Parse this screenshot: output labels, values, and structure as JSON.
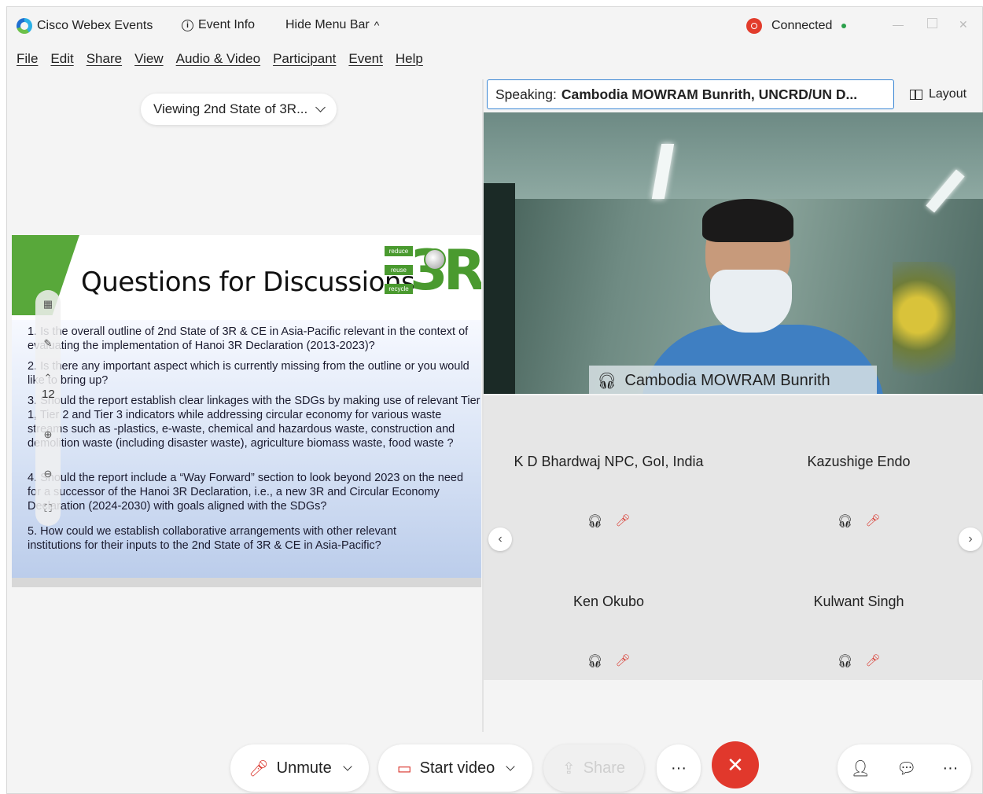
{
  "titlebar": {
    "app_name": "Cisco Webex Events",
    "event_info": "Event Info",
    "hide_menu": "Hide Menu Bar",
    "hide_menu_caret": "^",
    "status": "Connected"
  },
  "menu": [
    "File",
    "Edit",
    "Share",
    "View",
    "Audio & Video",
    "Participant",
    "Event",
    "Help"
  ],
  "viewing": {
    "label": "Viewing 2nd State of 3R..."
  },
  "slide": {
    "title": "Questions for Discussions",
    "logo_text": "3R",
    "logo_tags": [
      "reduce",
      "reuse",
      "recycle"
    ],
    "questions": [
      "1. Is the overall outline of 2nd State of 3R & CE in Asia-Pacific relevant in the context of evaluating the implementation of Hanoi 3R Declaration (2013-2023)?",
      "2. Is there any important aspect which is currently missing from the outline or you would like to bring up?",
      "3. Should the report establish clear linkages with the SDGs by making use of relevant Tier 1, Tier 2 and Tier 3 indicators while addressing circular economy for various waste streams such as -plastics, e-waste, chemical and hazardous waste, construction and demolition waste (including disaster waste), agriculture biomass waste, food waste ?",
      "4. Should the report include a “Way Forward” section to look beyond 2023 on the need for a successor of the Hanoi 3R Declaration, i.e., a new 3R and Circular Economy Declaration (2024-2030) with goals aligned with the SDGs?",
      "5. How could we establish collaborative arrangements with other relevant institutions for their inputs to the 2nd State of 3R & CE in Asia-Pacific?"
    ],
    "page_number": "12"
  },
  "speaking": {
    "prefix": "Speaking:",
    "name": "Cambodia MOWRAM Bunrith, UNCRD/UN D..."
  },
  "layout_label": "Layout",
  "active_video": {
    "name": "Cambodia MOWRAM Bunrith"
  },
  "participants": [
    {
      "name": "K D Bhardwaj NPC, GoI, India"
    },
    {
      "name": "Kazushige Endo"
    },
    {
      "name": "Ken Okubo"
    },
    {
      "name": "Kulwant Singh"
    }
  ],
  "toolbar": {
    "unmute": "Unmute",
    "start_video": "Start video",
    "share": "Share",
    "more": "···",
    "end": "✕"
  },
  "colors": {
    "accent_blue": "#3a86d4",
    "end_red": "#e1382c",
    "status_green": "#2aa04a",
    "logo_green": "#4a9a2f"
  },
  "icons": {
    "app": "webex-logo-icon",
    "info": "info-icon",
    "record": "record-icon",
    "headphone": "headphone-icon",
    "mic_muted": "mic-muted-icon",
    "participants": "participants-icon",
    "chat": "chat-icon"
  }
}
